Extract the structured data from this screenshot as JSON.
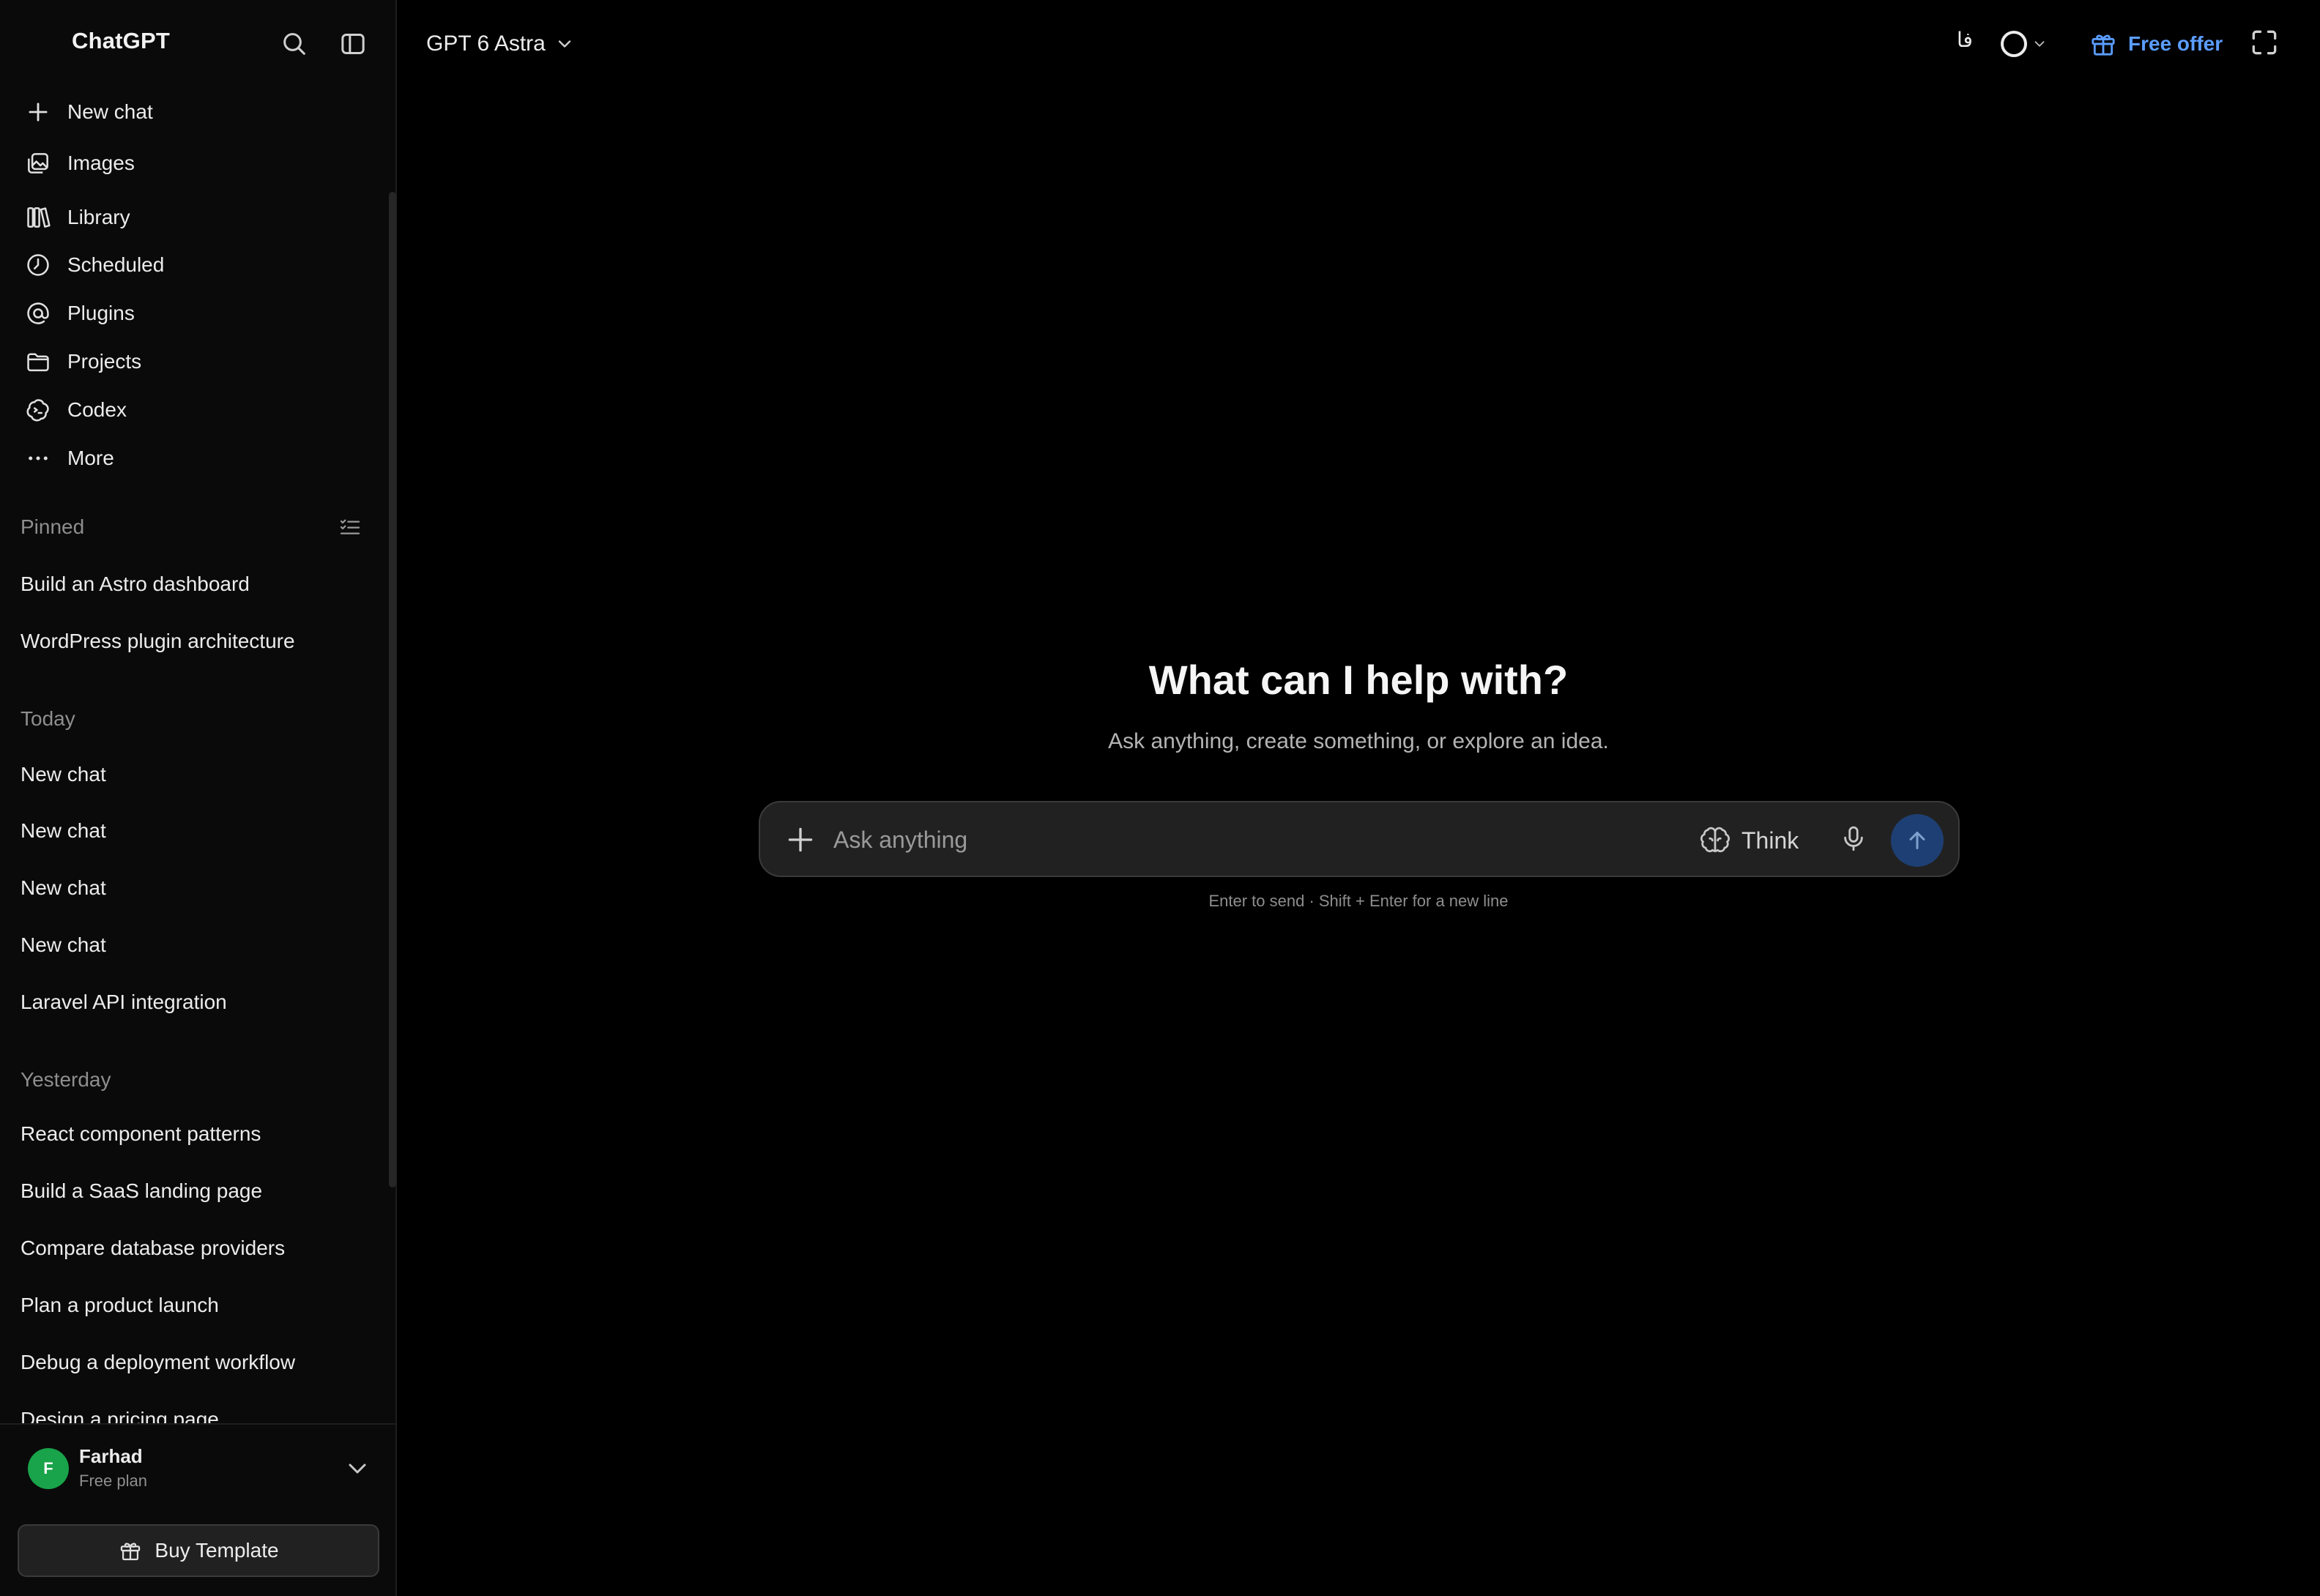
{
  "sidebar": {
    "brand": "ChatGPT",
    "header_icons": [
      "search-icon",
      "sidebar-toggle-icon"
    ],
    "nav": [
      {
        "label": "New chat",
        "icon": "plus-icon"
      },
      {
        "label": "Images",
        "icon": "images-icon"
      },
      {
        "label": "Library",
        "icon": "library-icon"
      },
      {
        "label": "Scheduled",
        "icon": "clock-icon"
      },
      {
        "label": "Plugins",
        "icon": "at-sign-icon"
      },
      {
        "label": "Projects",
        "icon": "folder-icon"
      },
      {
        "label": "Codex",
        "icon": "codex-icon"
      },
      {
        "label": "More",
        "icon": "ellipsis-icon"
      }
    ],
    "sections": {
      "pinned": {
        "title": "Pinned",
        "items": [
          "Build an Astro dashboard",
          "WordPress plugin architecture"
        ]
      },
      "today": {
        "title": "Today",
        "items": [
          "New chat",
          "New chat",
          "New chat",
          "New chat",
          "Laravel API integration"
        ]
      },
      "yesterday": {
        "title": "Yesterday",
        "items": [
          "React component patterns",
          "Build a SaaS landing page",
          "Compare database providers",
          "Plan a product launch",
          "Debug a deployment workflow",
          "Design a pricing page"
        ]
      }
    },
    "user": {
      "initial": "F",
      "name": "Farhad",
      "plan": "Free plan"
    },
    "buy_label": "Buy Template"
  },
  "topbar": {
    "model": "GPT 6 Astra",
    "language": "فا",
    "offer_label": "Free offer"
  },
  "main": {
    "title": "What can I help with?",
    "subtitle": "Ask anything, create something, or explore an idea.",
    "composer": {
      "placeholder": "Ask anything",
      "think_label": "Think"
    },
    "hint": "Enter to send · Shift + Enter for a new line"
  },
  "colors": {
    "background": "#000000",
    "sidebar": "#0a0a0a",
    "composer": "#212121",
    "accent_link": "#5b9dff",
    "send_button": "#1e3f73",
    "avatar": "#19a34a"
  }
}
